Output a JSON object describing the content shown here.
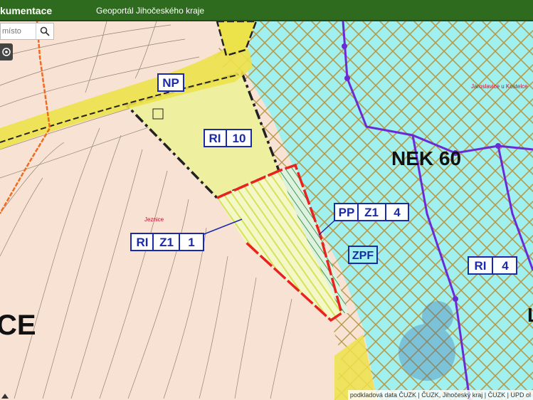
{
  "header": {
    "app_title": "kumentace",
    "portal_title": "Geoportál Jihočeského kraje"
  },
  "search": {
    "placeholder": "místo"
  },
  "map": {
    "labels": {
      "np": "NP",
      "ri10_a": "RI",
      "ri10_b": "10",
      "nek60": "NEK 60",
      "pp_a": "PP",
      "pp_b": "Z1",
      "pp_c": "4",
      "ri_z1_a": "RI",
      "ri_z1_b": "Z1",
      "ri_z1_c": "1",
      "zpf": "ZPF",
      "ri4_a": "RI",
      "ri4_b": "4",
      "jeznice": "Jeznice",
      "jaroslavice": "Jaroslavice u Kostelce",
      "big_ce": "CE",
      "big_l": "L"
    },
    "colors": {
      "background": "#f7e2d3",
      "water_hatch": "#9ff0ee",
      "hatch_line": "#b89a4a",
      "yellow_area": "#eef0a0",
      "road": "#ece24a",
      "boundary_red": "#e8231f",
      "boundary_purple": "#6a2bd6",
      "orange_line": "#f26a1f",
      "label_blue": "#1a2aa8"
    }
  },
  "attribution": {
    "text": "podkladová data ČUZK | ČUZK, Jihočeský kraj | ČUZK | UPD ol"
  }
}
